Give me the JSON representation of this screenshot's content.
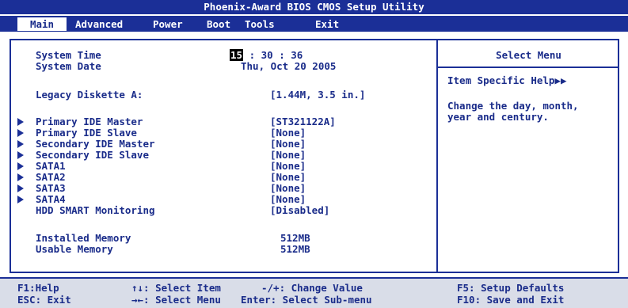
{
  "window": {
    "title": "Phoenix-Award BIOS CMOS Setup Utility"
  },
  "menu": [
    "Main",
    "Advanced",
    "Power",
    "Boot",
    "Tools",
    "Exit"
  ],
  "settings": {
    "system_time_label": "System Time",
    "time_hour": "15",
    "time_rest": ": 30 : 36",
    "system_date_label": "System Date",
    "system_date_value": "Thu, Oct 20 2005",
    "legacy_diskette_label": "Legacy Diskette A:",
    "legacy_diskette_value": "[1.44M, 3.5 in.]",
    "items": [
      {
        "label": "Primary IDE Master",
        "value": "[ST321122A]"
      },
      {
        "label": "Primary IDE Slave",
        "value": "[None]"
      },
      {
        "label": "Secondary IDE Master",
        "value": "[None]"
      },
      {
        "label": "Secondary IDE Slave",
        "value": "[None]"
      },
      {
        "label": "SATA1",
        "value": "[None]"
      },
      {
        "label": "SATA2",
        "value": "[None]"
      },
      {
        "label": "SATA3",
        "value": "[None]"
      },
      {
        "label": "SATA4",
        "value": "[None]"
      }
    ],
    "hdd_smart_label": "HDD SMART Monitoring",
    "hdd_smart_value": "[Disabled]",
    "installed_memory_label": "Installed Memory",
    "installed_memory_value": "512MB",
    "usable_memory_label": "Usable Memory",
    "usable_memory_value": "512MB"
  },
  "help": {
    "header": "Select Menu",
    "item_specific": "Item Specific Help▶▶",
    "line1": "Change the day, month,",
    "line2": "year and century."
  },
  "footer": {
    "f1": "F1:Help",
    "esc": "ESC: Exit",
    "updown": "↑↓: Select Item",
    "leftright": "→←: Select Menu",
    "change": "-/+: Change Value",
    "enter": "Enter: Select Sub-menu",
    "f5": "F5: Setup Defaults",
    "f10": "F10: Save and Exit"
  },
  "colors": {
    "bar": "#1b2f97",
    "text": "#1a2c8a",
    "footer_bg": "#d9dde8"
  }
}
